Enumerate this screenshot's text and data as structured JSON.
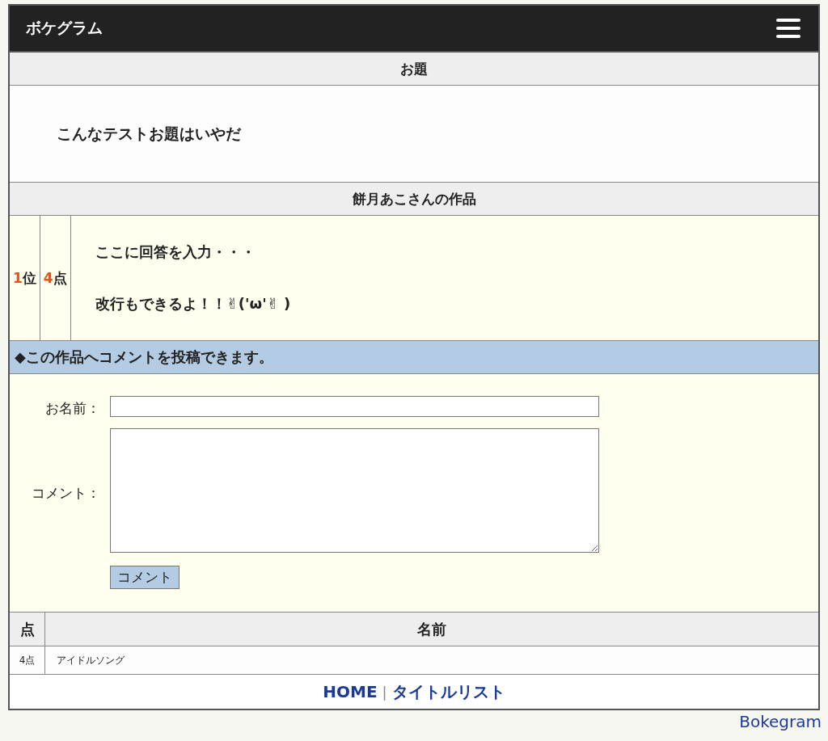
{
  "header": {
    "title": "ボケグラム"
  },
  "topic": {
    "heading": "お題",
    "text": "こんなテストお題はいやだ"
  },
  "work": {
    "heading": "餅月あこさんの作品",
    "rank": "1",
    "rank_unit": "位",
    "points": "4",
    "points_unit": "点",
    "lines": [
      "ここに回答を入力・・・",
      "改行もできるよ！！✌('ω'✌ )"
    ]
  },
  "comment_form": {
    "banner": "◆この作品へコメントを投稿できます。",
    "name_label": "お名前：",
    "comment_label": "コメント：",
    "submit": "コメント"
  },
  "votes": {
    "columns": [
      "点",
      "名前"
    ],
    "rows": [
      {
        "points": "4点",
        "name": "アイドルソング"
      }
    ]
  },
  "footer": {
    "links": [
      "HOME",
      "タイトルリスト"
    ],
    "separator": "|"
  },
  "brand": "Bokegram"
}
